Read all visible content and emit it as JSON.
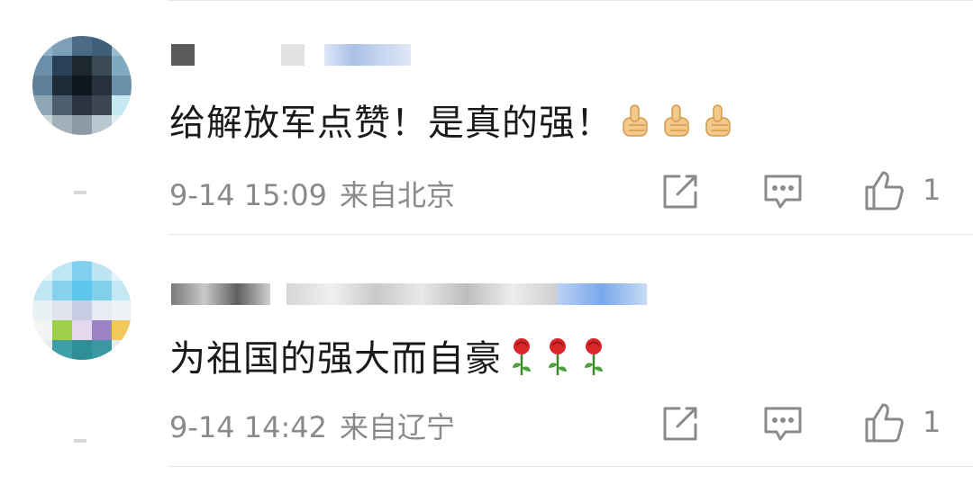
{
  "colors": {
    "text": "#1a1a1a",
    "meta": "#8a8a8a",
    "divider": "#e6e6e6"
  },
  "comments": [
    {
      "text": "给解放军点赞！是真的强！",
      "emojis": [
        "thumbs-up",
        "thumbs-up",
        "thumbs-up"
      ],
      "time": "9-14 15:09",
      "location": "来自北京",
      "likes": "1"
    },
    {
      "text": "为祖国的强大而自豪",
      "emojis": [
        "rose",
        "rose",
        "rose"
      ],
      "time": "9-14 14:42",
      "location": "来自辽宁",
      "likes": "1"
    }
  ]
}
